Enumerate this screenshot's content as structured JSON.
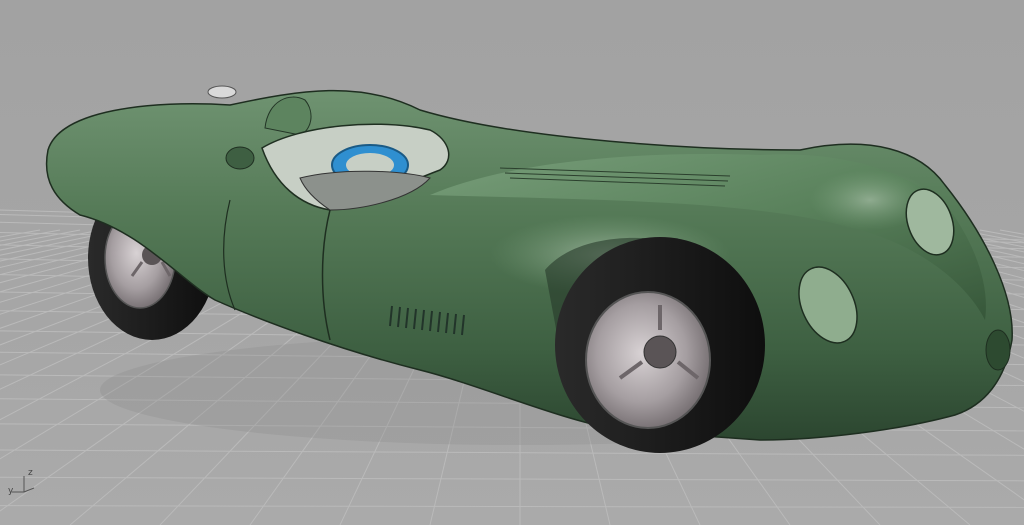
{
  "viewport": {
    "view": "perspective",
    "background_color": "#a4a4a4",
    "grid_color": "#b9b9b9",
    "model_color": "#4f7352"
  },
  "axis_gizmo": {
    "z_label": "z",
    "y_label": "y",
    "icon": "axis-gizmo-icon"
  }
}
